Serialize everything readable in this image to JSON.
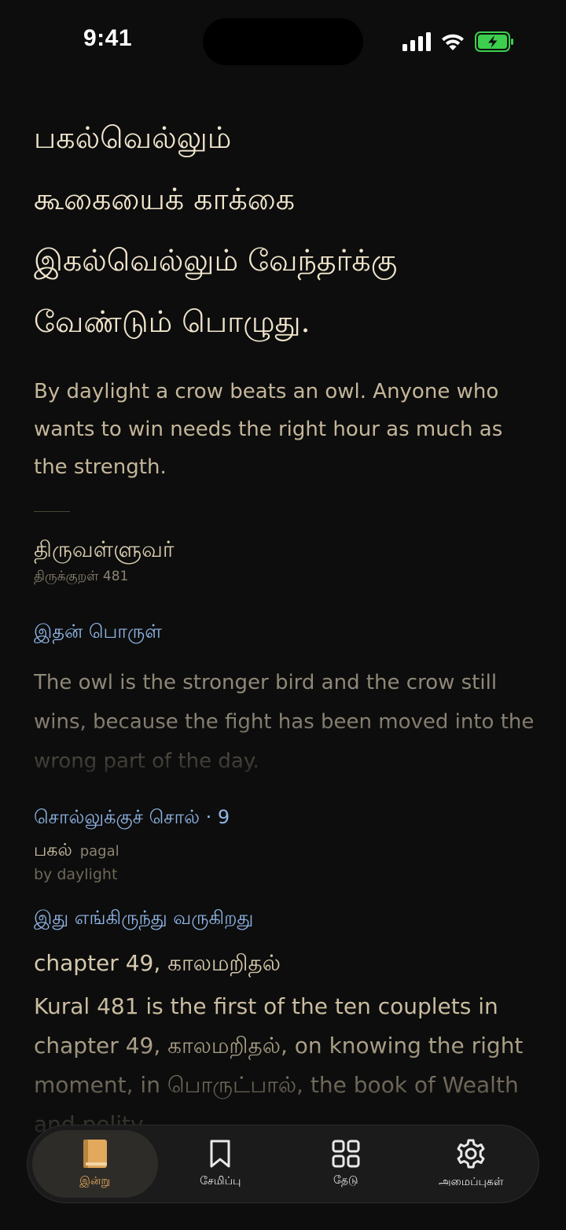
{
  "status_bar": {
    "time": "9:41",
    "icons": [
      "cellular-signal-icon",
      "wifi-icon",
      "battery-charging-icon"
    ],
    "battery_color": "#3ccf4e"
  },
  "verse": {
    "lines": [
      "பகல்வெல்லும்",
      "கூகையைக் காக்கை",
      "இகல்வெல்லும் வேந்தர்க்கு",
      "வேண்டும் பொழுது."
    ],
    "translation": "By daylight a crow beats an owl. Anyone who wants to win needs the right hour as much as the strength.",
    "author": "திருவள்ளுவர்",
    "reference": "திருக்குறள் 481"
  },
  "meaning": {
    "heading": "இதன் பொருள்",
    "text": "The owl is the stronger bird and the crow still wins, because the fight has been moved into the wrong part of the day."
  },
  "words": {
    "heading": "சொல்லுக்குச் சொல் · 9",
    "items": [
      {
        "tamil": "பகல்",
        "transliteration": "pagal",
        "gloss": "by daylight"
      }
    ]
  },
  "source": {
    "heading": "இது எங்கிருந்து வருகிறது",
    "title": "chapter 49, காலமறிதல்",
    "text": "Kural 481 is the first of the ten couplets in chapter 49, காலமறிதல், on knowing the right moment, in பொருட்பால், the book of Wealth and polity."
  },
  "tab_bar": {
    "accent_color": "#e2a85b",
    "tabs": [
      {
        "label": "இன்று",
        "icon": "book-icon",
        "active": true
      },
      {
        "label": "சேமிப்பு",
        "icon": "bookmark-icon",
        "active": false
      },
      {
        "label": "தேடு",
        "icon": "grid-icon",
        "active": false
      },
      {
        "label": "அமைப்புகள்",
        "icon": "gear-icon",
        "active": false
      }
    ]
  }
}
